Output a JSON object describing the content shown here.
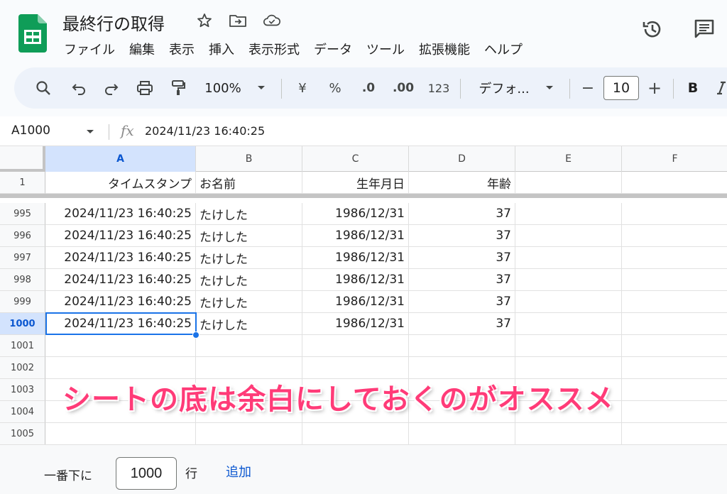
{
  "header": {
    "doc_title": "最終行の取得",
    "menu": [
      "ファイル",
      "編集",
      "表示",
      "挿入",
      "表示形式",
      "データ",
      "ツール",
      "拡張機能",
      "ヘルプ"
    ]
  },
  "toolbar": {
    "zoom": "100%",
    "currency": "¥",
    "percent": "%",
    "decrease_decimal": ".0",
    "increase_decimal": ".00",
    "number_format": "123",
    "font_name": "デフォ...",
    "minus": "−",
    "font_size": "10",
    "plus": "+",
    "bold": "B"
  },
  "formula_bar": {
    "name_box": "A1000",
    "fx": "fx",
    "formula": "2024/11/23 16:40:25"
  },
  "grid": {
    "columns": [
      "A",
      "B",
      "C",
      "D",
      "E",
      "F"
    ],
    "selected_column": "A",
    "header_row": {
      "row": "1",
      "cells": [
        "タイムスタンプ",
        "お名前",
        "生年月日",
        "年齢",
        "",
        ""
      ]
    },
    "rows": [
      {
        "row": "995",
        "cells": [
          "2024/11/23 16:40:25",
          "たけした",
          "1986/12/31",
          "37",
          "",
          ""
        ]
      },
      {
        "row": "996",
        "cells": [
          "2024/11/23 16:40:25",
          "たけした",
          "1986/12/31",
          "37",
          "",
          ""
        ]
      },
      {
        "row": "997",
        "cells": [
          "2024/11/23 16:40:25",
          "たけした",
          "1986/12/31",
          "37",
          "",
          ""
        ]
      },
      {
        "row": "998",
        "cells": [
          "2024/11/23 16:40:25",
          "たけした",
          "1986/12/31",
          "37",
          "",
          ""
        ]
      },
      {
        "row": "999",
        "cells": [
          "2024/11/23 16:40:25",
          "たけした",
          "1986/12/31",
          "37",
          "",
          ""
        ]
      },
      {
        "row": "1000",
        "cells": [
          "2024/11/23 16:40:25",
          "たけした",
          "1986/12/31",
          "37",
          "",
          ""
        ]
      },
      {
        "row": "1001",
        "cells": [
          "",
          "",
          "",
          "",
          "",
          ""
        ]
      },
      {
        "row": "1002",
        "cells": [
          "",
          "",
          "",
          "",
          "",
          ""
        ]
      },
      {
        "row": "1003",
        "cells": [
          "",
          "",
          "",
          "",
          "",
          ""
        ]
      },
      {
        "row": "1004",
        "cells": [
          "",
          "",
          "",
          "",
          "",
          ""
        ]
      },
      {
        "row": "1005",
        "cells": [
          "",
          "",
          "",
          "",
          "",
          ""
        ]
      }
    ],
    "selected_row": "1000"
  },
  "overlay": {
    "caption": "シートの底は余白にしておくのがオススメ"
  },
  "add_rows": {
    "label": "一番下に",
    "value": "1000",
    "unit": "行",
    "button": "追加"
  },
  "colors": {
    "accent": "#1a73e8",
    "caption": "#ff3b78",
    "sheets_green": "#0f9d58"
  }
}
